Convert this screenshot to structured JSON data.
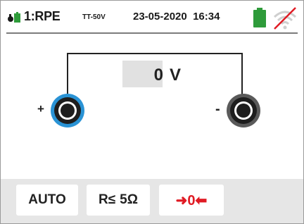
{
  "status": {
    "test_mode": "1:RPE",
    "test_mode_sub": "TT-50V",
    "date": "23-05-2020",
    "time": "16:34",
    "battery_icon": "battery-icon",
    "wifi_icon": "wifi-disabled-icon"
  },
  "measurement": {
    "value": "0",
    "unit": "V",
    "plus_label": "+",
    "minus_label": "-"
  },
  "softkeys": {
    "auto_label": "AUTO",
    "limit_prefix": "R≤",
    "limit_value": "5Ω",
    "zero_label": "➜0⬅"
  },
  "colors": {
    "positive_terminal": "#2a93d5",
    "negative_terminal": "#5a5a5a",
    "zero_button_text": "#e01b24",
    "battery": "#2e9b3a",
    "wifi_slash": "#e01b24"
  }
}
